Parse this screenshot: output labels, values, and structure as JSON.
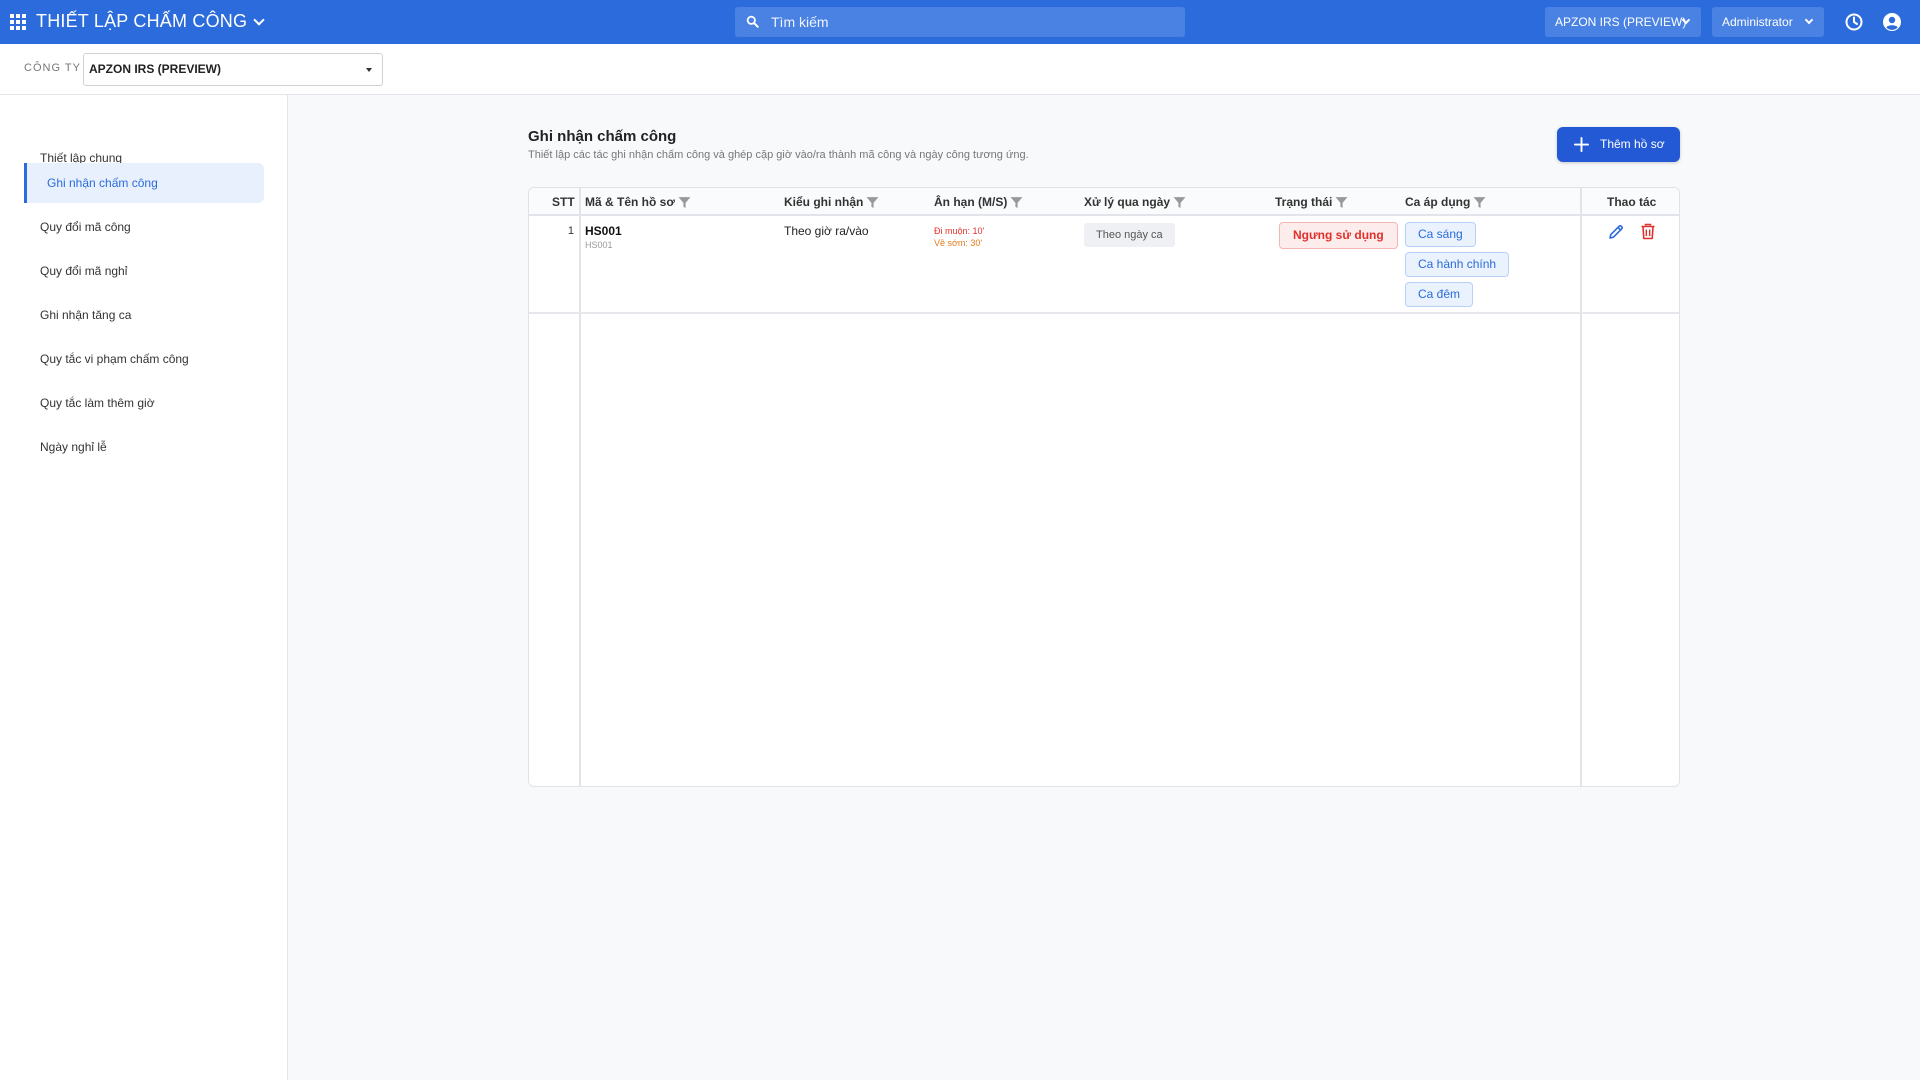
{
  "header": {
    "app_title": "THIẾT LẬP CHẤM CÔNG",
    "search_placeholder": "Tìm kiếm",
    "company_switch": "APZON IRS (PREVIEW)",
    "user": "Administrator"
  },
  "subheader": {
    "company_label": "CÔNG TY",
    "company_value": "APZON IRS (PREVIEW)"
  },
  "sidebar": {
    "items": [
      {
        "label": "Thiết lập chung"
      },
      {
        "label": "Ghi nhận chấm công"
      },
      {
        "label": "Quy đổi mã công"
      },
      {
        "label": "Quy đổi mã nghỉ"
      },
      {
        "label": "Ghi nhận tăng ca"
      },
      {
        "label": "Quy tắc vi phạm chấm công"
      },
      {
        "label": "Quy tắc làm thêm giờ"
      },
      {
        "label": "Ngày nghỉ lễ"
      }
    ],
    "active_index": 1
  },
  "main": {
    "title": "Ghi nhận chấm công",
    "subtitle": "Thiết lập các tác ghi nhận chấm công và ghép cặp giờ vào/ra thành mã công và ngày công tương ứng.",
    "add_button": "Thêm hồ sơ"
  },
  "table": {
    "columns": [
      "STT",
      "Mã & Tên hồ sơ",
      "Kiểu ghi nhận",
      "Ân hạn (M/S)",
      "Xử lý qua ngày",
      "Trạng thái",
      "Ca áp dụng",
      "Thao tác"
    ],
    "rows": [
      {
        "stt": "1",
        "code": "HS001",
        "name": "HS001",
        "type": "Theo giờ ra/vào",
        "grace_late": "Đi muộn: 10'",
        "grace_early": "Về sớm: 30'",
        "overday": "Theo ngày ca",
        "status": "Ngưng sử dụng",
        "shifts": [
          "Ca sáng",
          "Ca hành chính",
          "Ca đêm"
        ]
      }
    ]
  },
  "colors": {
    "primary": "#2b6bdb",
    "button": "#2459d6",
    "danger": "#e0302b",
    "warning": "#e07b1a"
  }
}
